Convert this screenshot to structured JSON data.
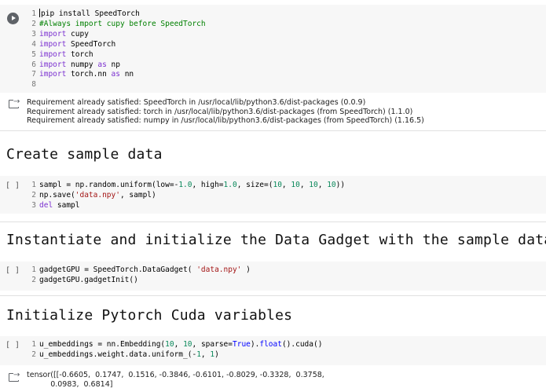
{
  "cells": [
    {
      "id": "install",
      "lines": [
        [
          "1",
          [
            [
              "",
              "pip install SpeedTorch"
            ]
          ]
        ],
        [
          "2",
          [
            [
              "cm",
              "#Always import cupy before SpeedTorch"
            ]
          ]
        ],
        [
          "3",
          [
            [
              "kw",
              "import"
            ],
            [
              "",
              " cupy"
            ]
          ]
        ],
        [
          "4",
          [
            [
              "kw",
              "import"
            ],
            [
              "",
              " SpeedTorch"
            ]
          ]
        ],
        [
          "5",
          [
            [
              "kw",
              "import"
            ],
            [
              "",
              " torch"
            ]
          ]
        ],
        [
          "6",
          [
            [
              "kw",
              "import"
            ],
            [
              "",
              " numpy "
            ],
            [
              "kw",
              "as"
            ],
            [
              "",
              " np"
            ]
          ]
        ],
        [
          "7",
          [
            [
              "kw",
              "import"
            ],
            [
              "",
              " torch.nn "
            ],
            [
              "kw",
              "as"
            ],
            [
              "",
              " nn"
            ]
          ]
        ],
        [
          "8",
          []
        ]
      ],
      "output": [
        "Requirement already satisfied: SpeedTorch in /usr/local/lib/python3.6/dist-packages (0.0.9)",
        "Requirement already satisfied: torch in /usr/local/lib/python3.6/dist-packages (from SpeedTorch) (1.1.0)",
        "Requirement already satisfied: numpy in /usr/local/lib/python3.6/dist-packages (from SpeedTorch) (1.16.5)"
      ]
    },
    {
      "id": "sample",
      "exec_label": "[ ]",
      "lines": [
        [
          "1",
          [
            [
              "",
              "sampl = np.random.uniform(low=-"
            ],
            [
              "nm",
              "1.0"
            ],
            [
              "",
              ", high="
            ],
            [
              "nm",
              "1.0"
            ],
            [
              "",
              ", size=("
            ],
            [
              "nm",
              "10"
            ],
            [
              "",
              ", "
            ],
            [
              "nm",
              "10"
            ],
            [
              "",
              ", "
            ],
            [
              "nm",
              "10"
            ],
            [
              "",
              ", "
            ],
            [
              "nm",
              "10"
            ],
            [
              "",
              "))"
            ]
          ]
        ],
        [
          "2",
          [
            [
              "",
              "np.save("
            ],
            [
              "st",
              "'data.npy'"
            ],
            [
              "",
              ", sampl)"
            ]
          ]
        ],
        [
          "3",
          [
            [
              "kw",
              "del"
            ],
            [
              "",
              " sampl"
            ]
          ]
        ]
      ]
    },
    {
      "id": "gadget",
      "exec_label": "[ ]",
      "lines": [
        [
          "1",
          [
            [
              "",
              "gadgetGPU = SpeedTorch.DataGadget( "
            ],
            [
              "st",
              "'data.npy'"
            ],
            [
              "",
              " )"
            ]
          ]
        ],
        [
          "2",
          [
            [
              "",
              "gadgetGPU.gadgetInit()"
            ]
          ]
        ]
      ]
    },
    {
      "id": "embed",
      "exec_label": "[ ]",
      "lines": [
        [
          "1",
          [
            [
              "",
              "u_embeddings = nn.Embedding("
            ],
            [
              "nm",
              "10"
            ],
            [
              "",
              ", "
            ],
            [
              "nm",
              "10"
            ],
            [
              "",
              ", sparse="
            ],
            [
              "bl",
              "True"
            ],
            [
              "",
              ")."
            ],
            [
              "bl",
              "float"
            ],
            [
              "",
              "().cuda()"
            ]
          ]
        ],
        [
          "2",
          [
            [
              "",
              "u_embeddings.weight.data.uniform_(-"
            ],
            [
              "nm",
              "1"
            ],
            [
              "",
              ", "
            ],
            [
              "nm",
              "1"
            ],
            [
              "",
              ")"
            ]
          ]
        ]
      ],
      "output": [
        "tensor([[-0.6605,  0.1747,  0.1516, -0.3846, -0.6101, -0.8029, -0.3328,  0.3758,",
        "          0.0983,  0.6814]"
      ]
    }
  ],
  "headers": {
    "sample": "Create sample data",
    "gadget": "Instantiate and initialize the Data Gadget with the sample data",
    "cuda": "Initialize Pytorch Cuda variables"
  }
}
